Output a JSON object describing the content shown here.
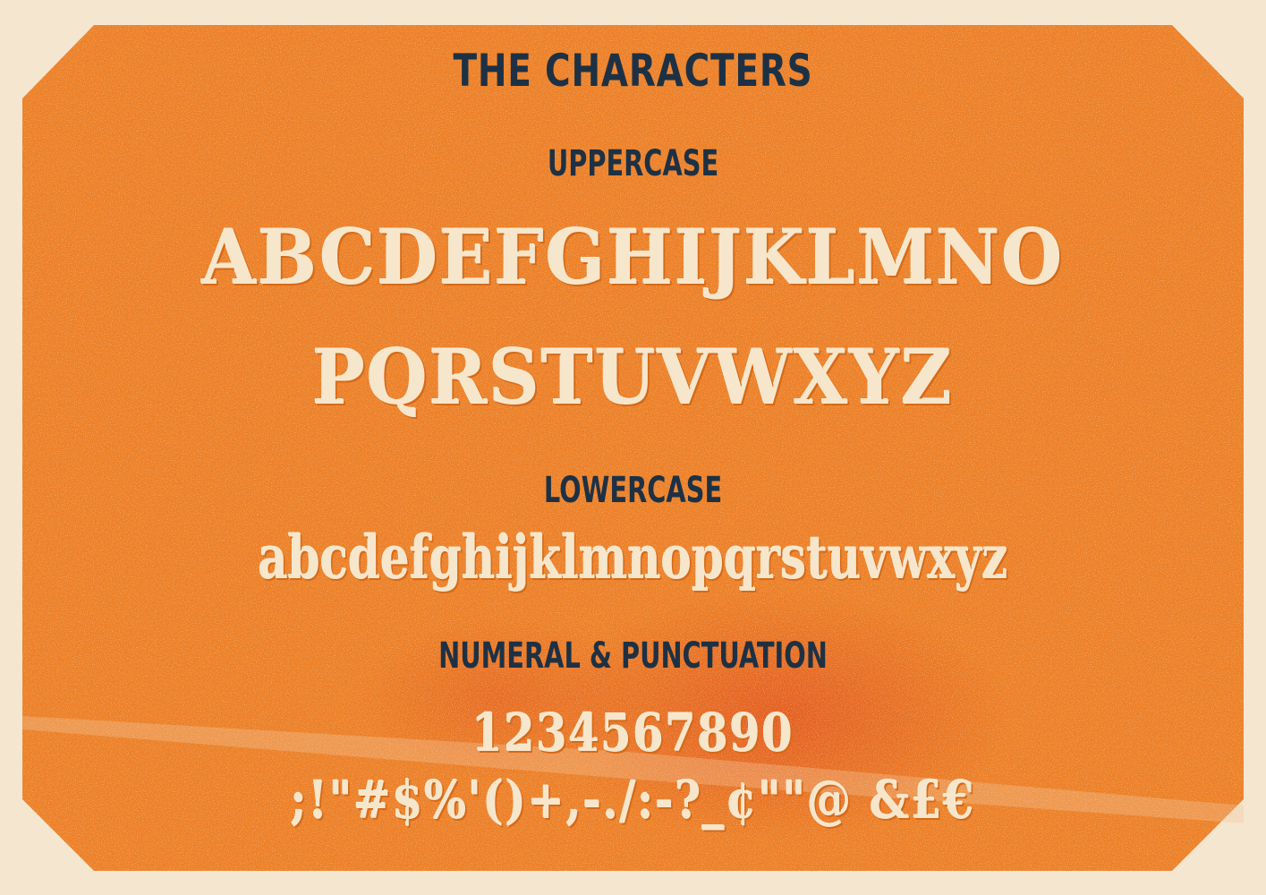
{
  "title": "THE CHARACTERS",
  "sections": {
    "uppercase": {
      "label": "UPPERCASE",
      "row1": "ABCDEFGHIJKLMNO",
      "row2": "PQRSTUVWXYZ"
    },
    "lowercase": {
      "label": "LOWERCASE",
      "row": "abcdefghijklmnopqrstuvwxyz"
    },
    "numeral": {
      "label": "NUMERAL & PUNCTUATION",
      "numerals": "1234567890",
      "punctuation": ";!\"#$%'()+,-./:-?_¢\"\"@ &£€"
    }
  },
  "colors": {
    "card": "#ec7f26",
    "background": "#f5e6d0",
    "heading": "#1e3144",
    "glyph": "#f6e6cc"
  }
}
